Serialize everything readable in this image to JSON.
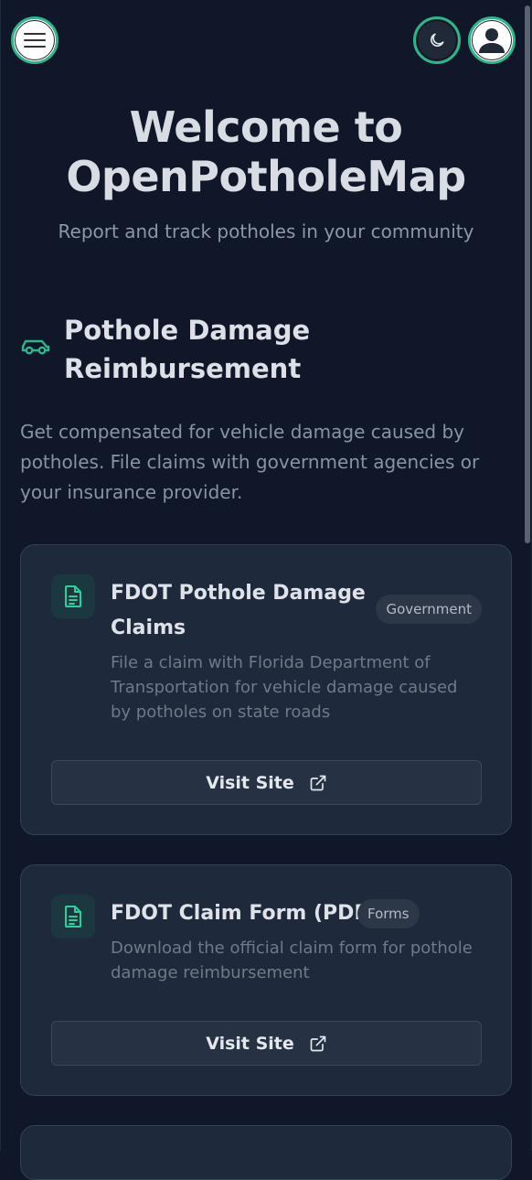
{
  "header": {
    "menu_icon": "hamburger-menu-icon",
    "theme_icon": "moon-icon",
    "account_icon": "user-avatar-icon"
  },
  "hero": {
    "title_line1": "Welcome to",
    "title_line2": "OpenPotholeMap",
    "subtitle": "Report and track potholes in your community"
  },
  "section": {
    "icon": "car-icon",
    "title_line1": "Pothole Damage",
    "title_line2": "Reimbursement",
    "description": "Get compensated for vehicle damage caused by potholes. File claims with government agencies or your insurance provider."
  },
  "resources": [
    {
      "icon": "document-icon",
      "title_line1": "FDOT Pothole Damage",
      "title_line2": "Claims",
      "badge": "Government",
      "description": "File a claim with Florida Department of Transportation for vehicle damage caused by potholes on state roads",
      "button_label": "Visit Site"
    },
    {
      "icon": "document-icon",
      "title_line1": "FDOT Claim Form (PDF)",
      "badge": "Forms",
      "description": "Download the official claim form for pothole damage reimbursement",
      "button_label": "Visit Site"
    }
  ],
  "colors": {
    "background": "#0f1729",
    "card": "#1e293b",
    "accent": "#2bb78a"
  }
}
